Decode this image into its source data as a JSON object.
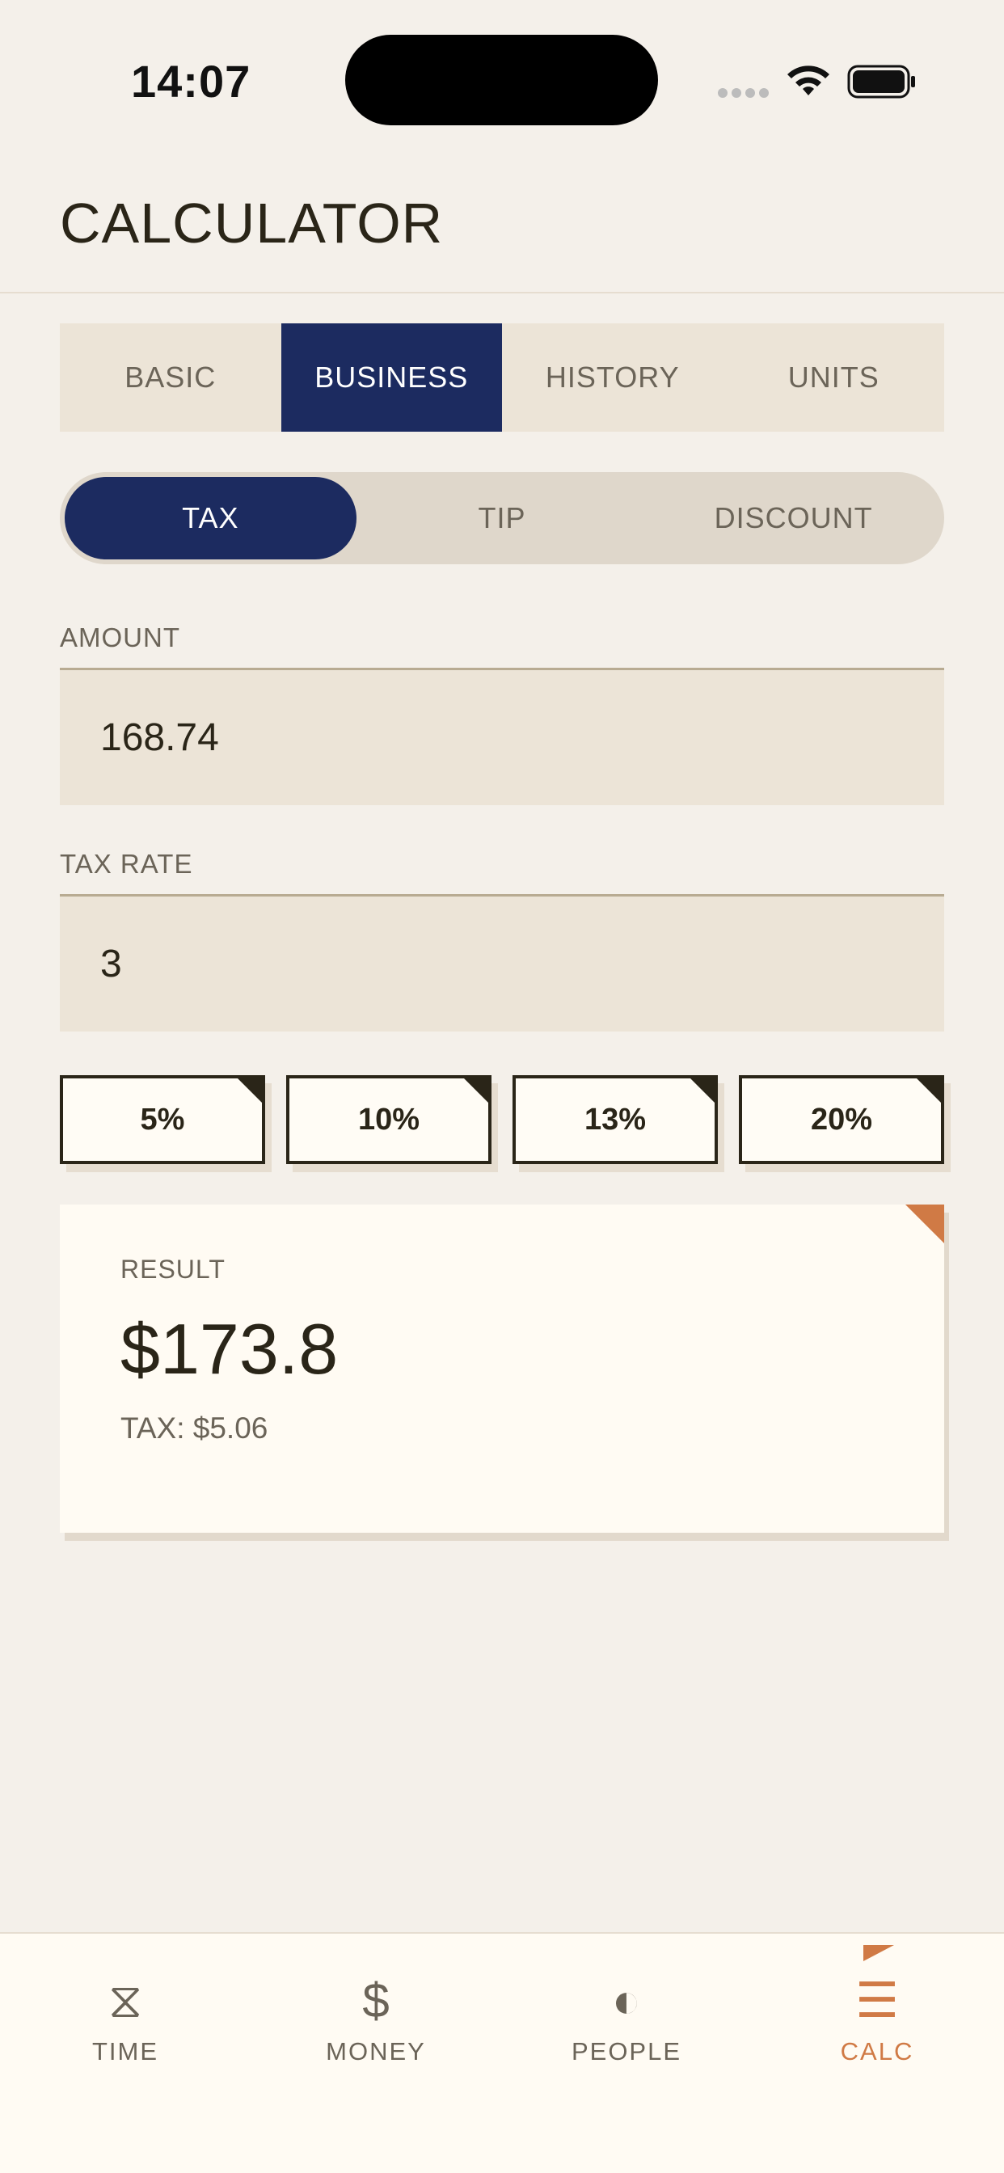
{
  "status_bar": {
    "time": "14:07"
  },
  "header": {
    "title": "CALCULATOR"
  },
  "mode_tabs": [
    {
      "label": "BASIC",
      "active": false
    },
    {
      "label": "BUSINESS",
      "active": true
    },
    {
      "label": "HISTORY",
      "active": false
    },
    {
      "label": "UNITS",
      "active": false
    }
  ],
  "segments": [
    {
      "label": "TAX",
      "active": true
    },
    {
      "label": "TIP",
      "active": false
    },
    {
      "label": "DISCOUNT",
      "active": false
    }
  ],
  "amount": {
    "label": "AMOUNT",
    "value": "168.74"
  },
  "tax_rate": {
    "label": "TAX RATE",
    "value": "3"
  },
  "presets": [
    "5%",
    "10%",
    "13%",
    "20%"
  ],
  "result": {
    "label": "RESULT",
    "value": "$173.8",
    "detail": "TAX: $5.06"
  },
  "bottom_nav": [
    {
      "label": "TIME",
      "icon": "hourglass-icon",
      "glyph": "⧖",
      "active": false
    },
    {
      "label": "MONEY",
      "icon": "dollar-icon",
      "glyph": "$",
      "active": false
    },
    {
      "label": "PEOPLE",
      "icon": "half-circle-icon",
      "glyph": "◐",
      "active": false
    },
    {
      "label": "CALC",
      "icon": "menu-icon",
      "glyph": "☰",
      "active": true
    }
  ],
  "colors": {
    "accent_navy": "#1c2b60",
    "accent_orange": "#d07a45",
    "background": "#f4f0ea",
    "card": "#fffbf3"
  }
}
